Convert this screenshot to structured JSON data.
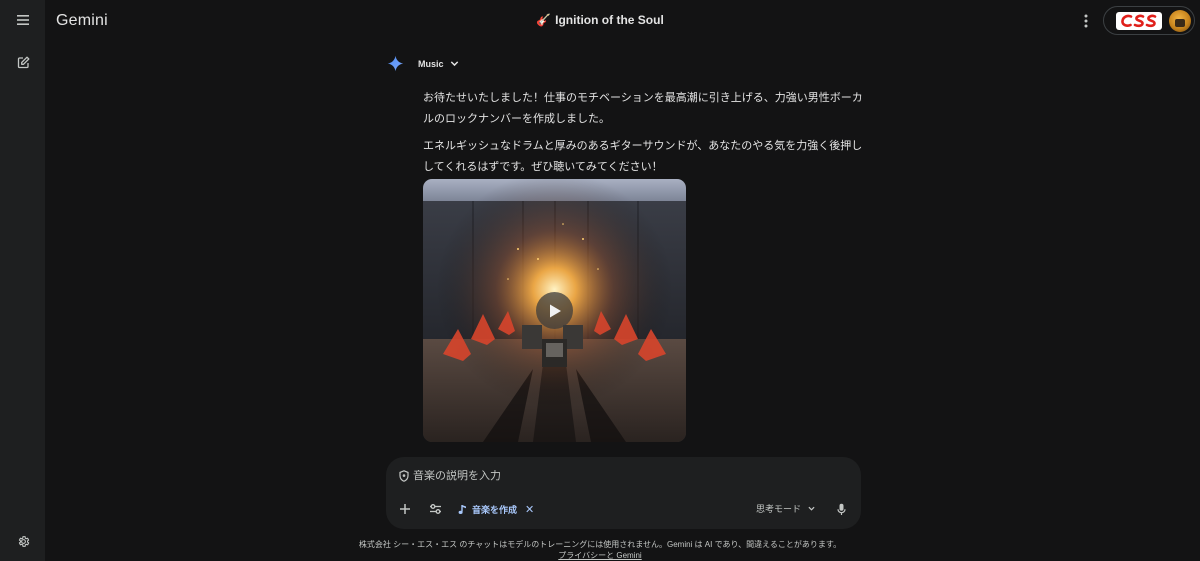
{
  "app": {
    "title": "Gemini"
  },
  "chat": {
    "emoji": "🎸",
    "title": "Ignition of the Soul"
  },
  "model": {
    "label": "Music"
  },
  "response": {
    "paragraphs": [
      "お待たせいたしました！仕事のモチベーションを最高潮に引き上げる、力強い男性ボーカルのロックナンバーを作成しました。",
      "エネルギッシュなドラムと厚みのあるギターサウンドが、あなたのやる気を力強く後押ししてくれるはずです。ぜひ聴いてみてください！"
    ]
  },
  "composer": {
    "placeholder": "音楽の説明を入力",
    "chip_label": "音楽を作成",
    "chip_close": "✕",
    "mode_label": "思考モード"
  },
  "footer": {
    "disclaimer": "株式会社 シー・エス・エス のチャットはモデルのトレーニングには使用されません。Gemini は AI であり、間違えることがあります。",
    "link": "プライバシーと Gemini"
  },
  "icons": {
    "menu": "menu-icon",
    "new_chat": "edit-icon",
    "settings": "gear-icon",
    "more": "more-vert-icon",
    "spark": "gemini-spark-icon",
    "shield": "shield-icon",
    "add": "plus-icon",
    "tools": "tune-icon",
    "music": "music-note-icon",
    "mic": "mic-icon",
    "play": "play-icon"
  },
  "colors": {
    "background": "#131314",
    "rail": "#1e1f20",
    "composer": "#1e1f20",
    "accent": "#a8c7fa",
    "text": "#e3e3e3"
  }
}
